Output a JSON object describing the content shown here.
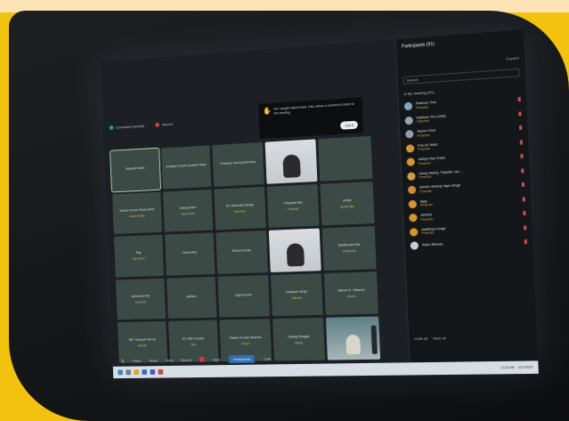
{
  "meeting": {
    "notice_text": "Hi! I caught  raised  hand. Give others a moment to  teach in the meeting",
    "notice_button": "Got it",
    "topbar": [
      "Connected securely",
      "Record"
    ]
  },
  "tiles": [
    {
      "name": "Mayank Shah",
      "sub": "",
      "active": true
    },
    {
      "name": "Kundan Kumar (Leader Mac)",
      "sub": ""
    },
    {
      "name": "Prashan Sinha (Director)",
      "sub": ""
    },
    {
      "name": "",
      "sub": "",
      "video": "a"
    },
    {
      "name": "",
      "sub": "",
      "video": "none"
    },
    {
      "name": "Ashok Kumar Tiwari (HR)",
      "sub": "Ashok Kumar"
    },
    {
      "name": "Manoj Saini",
      "sub": "Manoj Saini"
    },
    {
      "name": "Dr. Narendra Singh",
      "sub": "Narendra"
    },
    {
      "name": "Priyanka Rai",
      "sub": "Priyanka"
    },
    {
      "name": "Amita",
      "sub": "Amita Ram"
    },
    {
      "name": "Raj",
      "sub": "Raj Kapoor"
    },
    {
      "name": "Vinod Roy",
      "sub": ""
    },
    {
      "name": "Rahul Kumar",
      "sub": ""
    },
    {
      "name": "",
      "sub": "",
      "video": "a"
    },
    {
      "name": "Shailendra Rai",
      "sub": "Shailendra"
    },
    {
      "name": "Ashutosh Pal",
      "sub": "Ashutosh"
    },
    {
      "name": "sadhan",
      "sub": ""
    },
    {
      "name": "Ajay Kumar",
      "sub": ""
    },
    {
      "name": "Kalpana Singh",
      "sub": "Kalpana"
    },
    {
      "name": "Vikram K. Sharma",
      "sub": "Vikram"
    },
    {
      "name": "MR. Deepak Verma",
      "sub": "Deepak"
    },
    {
      "name": "Dr. Nitin Kumar",
      "sub": "Nitin"
    },
    {
      "name": "Pawan Kumar Sharma",
      "sub": "Pawan"
    },
    {
      "name": "Sanjay Bhagat",
      "sub": "Sanjay"
    },
    {
      "name": "",
      "sub": "",
      "video": "b"
    }
  ],
  "panel": {
    "title": "Participants (91)",
    "close": "Expand",
    "search_placeholder": "Search",
    "group": "In the meeting (91)",
    "participants": [
      {
        "name": "Rakhee Thul",
        "role": "Presenter",
        "color": "#7aa6c9"
      },
      {
        "name": "Rakhee Thul (SM)",
        "role": "Organiser",
        "color": "#9aa3ab"
      },
      {
        "name": "Super Chat",
        "role": "Presenter",
        "color": "#8c9bb0"
      },
      {
        "name": "Pris AT MAX",
        "role": "Presenter",
        "color": "#d6942e"
      },
      {
        "name": "Aditya Raj Hrishi",
        "role": "Presenter",
        "color": "#d6942e"
      },
      {
        "name": "Vinay Mistry, Tripathi, Ho...",
        "role": "Presenter",
        "color": "#c9a03b"
      },
      {
        "name": "ashok Hindraj Jaya Singh",
        "role": "Presenter",
        "color": "#d18a3a"
      },
      {
        "name": "Ajay",
        "role": "Presenter",
        "color": "#d6942e"
      },
      {
        "name": "AIMKA",
        "role": "Presenter",
        "color": "#d6942e"
      },
      {
        "name": "Aadithya Singh",
        "role": "Presenter",
        "color": "#d6942e"
      },
      {
        "name": "Arjun Biswas",
        "role": "",
        "color": "#c7ced3"
      }
    ],
    "footer": [
      "Invite all",
      "Mute all"
    ]
  },
  "toolbar": {
    "items": [
      "Mic",
      "Raise",
      "React",
      "View",
      "Record",
      "Apps",
      "Rooms"
    ],
    "participants_label": "Participants",
    "chat_label": "Chat"
  },
  "taskbar": {
    "time": "11:32 AM",
    "date": "3/17/2023"
  },
  "colors": {
    "frame": "#f2c20f",
    "tile": "#3b4a45",
    "accent": "#2f6fb3"
  }
}
